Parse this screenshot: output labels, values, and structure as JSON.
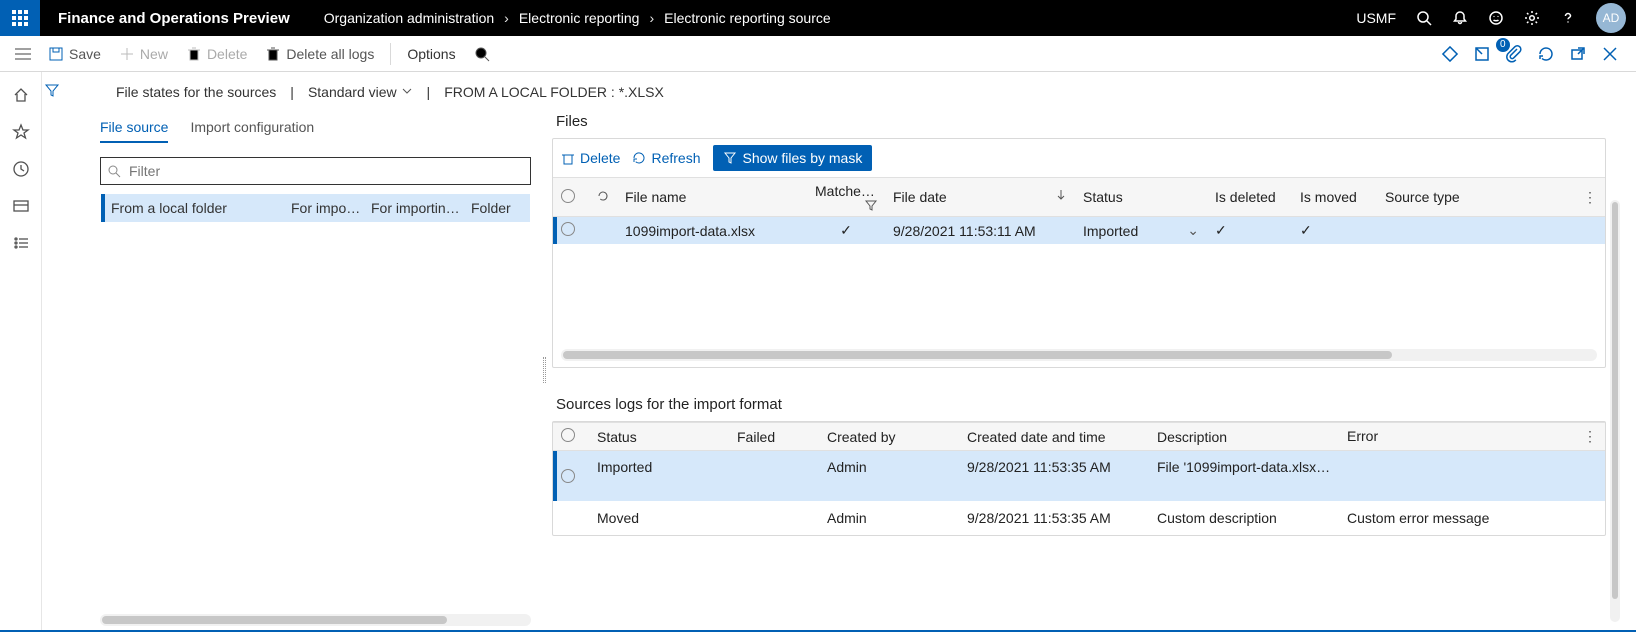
{
  "topbar": {
    "app_title": "Finance and Operations Preview",
    "breadcrumbs": [
      "Organization administration",
      "Electronic reporting",
      "Electronic reporting source"
    ],
    "company": "USMF",
    "avatar": "AD",
    "attach_badge": "0"
  },
  "actions": {
    "save": "Save",
    "new": "New",
    "delete": "Delete",
    "delete_all_logs": "Delete all logs",
    "options": "Options"
  },
  "subheader": {
    "title": "File states for the sources",
    "view_label": "Standard view",
    "context": "FROM A LOCAL FOLDER : *.XLSX"
  },
  "tabs": {
    "file_source": "File source",
    "import_config": "Import configuration"
  },
  "filter_placeholder": "Filter",
  "file_source_grid": {
    "rows": [
      {
        "name": "From a local folder",
        "c2": "For impor…",
        "c3": "For importin…",
        "c4": "Folder"
      }
    ]
  },
  "files_panel": {
    "title": "Files",
    "delete": "Delete",
    "refresh": "Refresh",
    "show_by_mask": "Show files by mask",
    "columns": {
      "file_name": "File name",
      "matched": "Matche…",
      "file_date": "File date",
      "status": "Status",
      "is_deleted": "Is deleted",
      "is_moved": "Is moved",
      "source_type": "Source type"
    },
    "rows": [
      {
        "file_name": "1099import-data.xlsx",
        "matched": "✓",
        "file_date": "9/28/2021 11:53:11 AM",
        "status": "Imported",
        "is_deleted": "✓",
        "is_moved": "✓",
        "source_type": ""
      }
    ]
  },
  "logs_panel": {
    "title": "Sources logs for the import format",
    "columns": {
      "status": "Status",
      "failed": "Failed",
      "created_by": "Created by",
      "created_dt": "Created date and time",
      "description": "Description",
      "error": "Error"
    },
    "rows": [
      {
        "status": "Imported",
        "failed": "",
        "created_by": "Admin",
        "created_dt": "9/28/2021 11:53:35 AM",
        "description": "File '1099import-data.xlsx…",
        "error": ""
      },
      {
        "status": "Moved",
        "failed": "",
        "created_by": "Admin",
        "created_dt": "9/28/2021 11:53:35 AM",
        "description": "Custom description",
        "error": "Custom error message"
      }
    ]
  }
}
